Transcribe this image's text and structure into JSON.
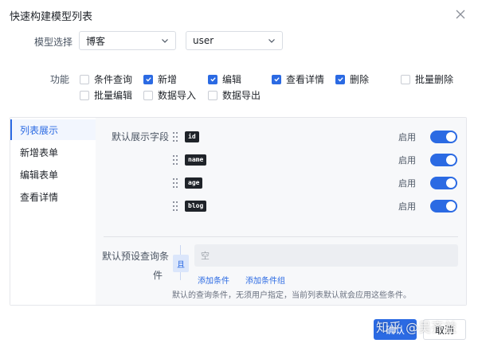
{
  "dialog": {
    "title": "快速构建模型列表"
  },
  "model_select": {
    "label": "模型选择",
    "model_value": "博客",
    "table_value": "user"
  },
  "features": {
    "label": "功能",
    "items": [
      {
        "label": "条件查询",
        "checked": false
      },
      {
        "label": "新增",
        "checked": true
      },
      {
        "label": "编辑",
        "checked": true
      },
      {
        "label": "查看详情",
        "checked": true
      },
      {
        "label": "删除",
        "checked": true
      },
      {
        "label": "批量删除",
        "checked": false
      },
      {
        "label": "批量编辑",
        "checked": false
      },
      {
        "label": "数据导入",
        "checked": false
      },
      {
        "label": "数据导出",
        "checked": false
      }
    ]
  },
  "nav": {
    "items": [
      {
        "label": "列表展示",
        "active": true
      },
      {
        "label": "新增表单",
        "active": false
      },
      {
        "label": "编辑表单",
        "active": false
      },
      {
        "label": "查看详情",
        "active": false
      }
    ]
  },
  "fields": {
    "label": "默认展示字段",
    "enable_label": "启用",
    "items": [
      {
        "name": "id",
        "enabled": true
      },
      {
        "name": "name",
        "enabled": true
      },
      {
        "name": "age",
        "enabled": true
      },
      {
        "name": "blog",
        "enabled": true
      }
    ]
  },
  "query": {
    "label_line1": "默认预设查询条",
    "label_line2": "件",
    "and_badge": "且",
    "placeholder": "空",
    "add_condition": "添加条件",
    "add_group": "添加条件组",
    "hint": "默认的查询条件，无须用户指定，当前列表默认就会应用这些条件。"
  },
  "footer": {
    "confirm_label": "确认",
    "cancel_label": "取消"
  },
  "watermark": {
    "text": "知乎 @吴齐益"
  },
  "colors": {
    "accent": "#2b6ae3",
    "panel_bg": "#f7f8fa"
  },
  "icons": {
    "close": "close-icon",
    "dropdown": "chevron-down-icon",
    "drag": "drag-handle-icon",
    "check": "check-icon"
  }
}
